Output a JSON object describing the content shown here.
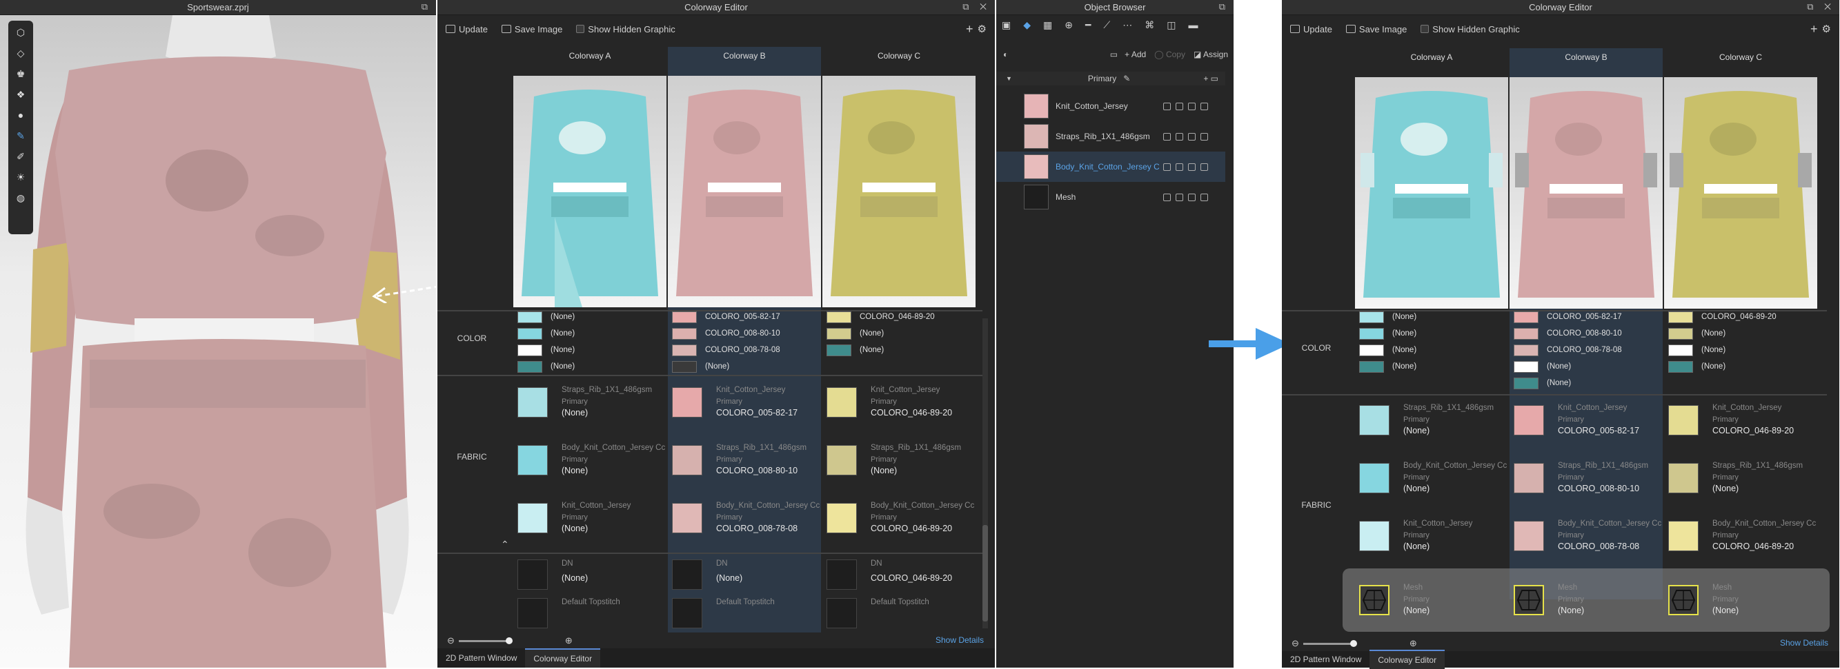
{
  "viewport": {
    "title": "Sportswear.zprj"
  },
  "colorway_editor": {
    "title": "Colorway Editor",
    "toolbar": {
      "update": "Update",
      "save_image": "Save Image",
      "show_hidden": "Show Hidden Graphic"
    },
    "columns": [
      "Colorway A",
      "Colorway B",
      "Colorway C"
    ],
    "row_labels": {
      "color": "COLOR",
      "fabric": "FABRIC"
    },
    "colors": [
      [
        {
          "swatch": "#a8e4ea",
          "label": "(None)"
        },
        {
          "swatch": "#86d6e0",
          "label": "(None)"
        },
        {
          "swatch": "#ffffff",
          "label": "(None)"
        },
        {
          "swatch": "#3f8c8c",
          "label": "(None)"
        }
      ],
      [
        {
          "swatch": "#e8aaaa",
          "label": "COLORO_005-82-17"
        },
        {
          "swatch": "#dcb0ae",
          "label": "COLORO_008-80-10"
        },
        {
          "swatch": "#d9b4b2",
          "label": "COLORO_008-78-08"
        },
        {
          "swatch": "#3a3a3a",
          "label": "(None)"
        }
      ],
      [
        {
          "swatch": "#e8df98",
          "label": "COLORO_046-89-20"
        },
        {
          "swatch": "#d2cc8e",
          "label": "(None)"
        },
        {
          "swatch": "#3f8c8c",
          "label": "(None)"
        }
      ]
    ],
    "colors_after": [
      [
        {
          "swatch": "#a8e4ea",
          "label": "(None)"
        },
        {
          "swatch": "#86d6e0",
          "label": "(None)"
        },
        {
          "swatch": "#ffffff",
          "label": "(None)"
        },
        {
          "swatch": "#3f8c8c",
          "label": "(None)"
        }
      ],
      [
        {
          "swatch": "#e8aaaa",
          "label": "COLORO_005-82-17"
        },
        {
          "swatch": "#dcb0ae",
          "label": "COLORO_008-80-10"
        },
        {
          "swatch": "#d9b4b2",
          "label": "COLORO_008-78-08"
        },
        {
          "swatch": "#ffffff",
          "label": "(None)"
        },
        {
          "swatch": "#3f8c8c",
          "label": "(None)"
        }
      ],
      [
        {
          "swatch": "#e8df98",
          "label": "COLORO_046-89-20"
        },
        {
          "swatch": "#d2cc8e",
          "label": "(None)"
        },
        {
          "swatch": "#ffffff",
          "label": "(None)"
        },
        {
          "swatch": "#3f8c8c",
          "label": "(None)"
        }
      ]
    ],
    "primary": "Primary",
    "fabrics": [
      [
        {
          "name": "Straps_Rib_1X1_486gsm",
          "value": "(None)",
          "color": "#a8dfe4"
        },
        {
          "name": "Body_Knit_Cotton_Jersey Cc",
          "value": "(None)",
          "color": "#86d6e0"
        },
        {
          "name": "Knit_Cotton_Jersey",
          "value": "(None)",
          "color": "#c9eef2"
        }
      ],
      [
        {
          "name": "Knit_Cotton_Jersey",
          "value": "COLORO_005-82-17",
          "color": "#e6a9aa"
        },
        {
          "name": "Straps_Rib_1X1_486gsm",
          "value": "COLORO_008-80-10",
          "color": "#d6b1ae"
        },
        {
          "name": "Body_Knit_Cotton_Jersey Cc",
          "value": "COLORO_008-78-08",
          "color": "#e0b8b6"
        }
      ],
      [
        {
          "name": "Knit_Cotton_Jersey",
          "value": "COLORO_046-89-20",
          "color": "#e4dc92"
        },
        {
          "name": "Straps_Rib_1X1_486gsm",
          "value": "(None)",
          "color": "#cfc78e"
        },
        {
          "name": "Body_Knit_Cotton_Jersey Cc",
          "value": "COLORO_046-89-20",
          "color": "#eee49c"
        }
      ]
    ],
    "graphics": [
      [
        {
          "name": "DN",
          "value": "(None)"
        },
        {
          "name": "Default Topstitch",
          "value": ""
        }
      ],
      [
        {
          "name": "DN",
          "value": "(None)"
        },
        {
          "name": "Default Topstitch",
          "value": ""
        }
      ],
      [
        {
          "name": "DN",
          "value": "COLORO_046-89-20"
        },
        {
          "name": "Default Topstitch",
          "value": ""
        }
      ]
    ],
    "mesh": [
      {
        "name": "Mesh",
        "value": "(None)"
      },
      {
        "name": "Mesh",
        "value": "(None)"
      },
      {
        "name": "Mesh",
        "value": "(None)"
      }
    ],
    "show_details": "Show Details"
  },
  "object_browser": {
    "title": "Object Browser",
    "buttons": {
      "add": "Add",
      "copy": "Copy",
      "assign": "Assign"
    },
    "group": "Primary",
    "items": [
      {
        "name": "Knit_Cotton_Jersey",
        "color": "#e6b4b6",
        "selected": false
      },
      {
        "name": "Straps_Rib_1X1_486gsm",
        "color": "#dcb6b4",
        "selected": false
      },
      {
        "name": "Body_Knit_Cotton_Jersey Cc",
        "color": "#e8bcbc",
        "selected": true
      },
      {
        "name": "Mesh",
        "color": "#1e1e1e",
        "selected": false
      }
    ]
  },
  "bottom_tabs": [
    "2D Pattern Window",
    "Colorway Editor"
  ],
  "colors": {
    "panel": "#262626",
    "selected_column": "#2d3947",
    "accent_blue": "#5ba3e6",
    "arrow": "#4a9fe8"
  }
}
